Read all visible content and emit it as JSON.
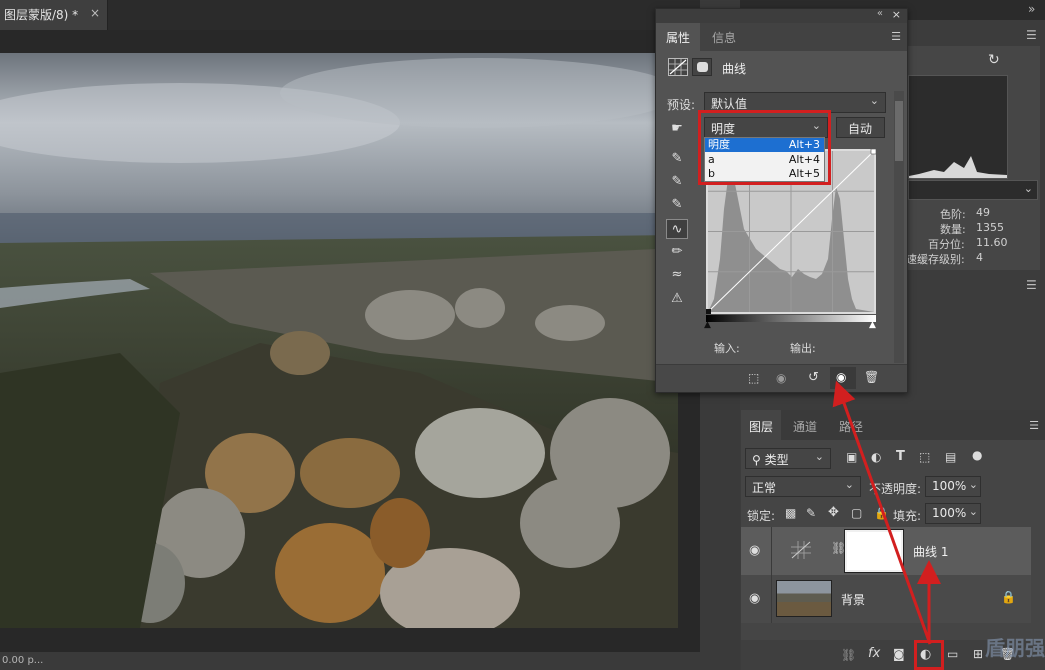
{
  "document": {
    "tab_title": "图层蒙版/8) *",
    "close_glyph": "×",
    "status_text": "0.00 p..."
  },
  "properties": {
    "tabs": [
      "属性",
      "信息"
    ],
    "adjustment_name": "曲线",
    "preset_label": "预设:",
    "preset_value": "默认值",
    "channel_value": "明度",
    "auto_button": "自动",
    "dropdown": [
      {
        "label": "明度",
        "shortcut": "Alt+3"
      },
      {
        "label": "a",
        "shortcut": "Alt+4"
      },
      {
        "label": "b",
        "shortcut": "Alt+5"
      }
    ],
    "input_label": "输入:",
    "output_label": "输出:"
  },
  "histogram": {
    "stats": [
      {
        "label": "色阶:",
        "value": "49"
      },
      {
        "label": "数量:",
        "value": "1355"
      },
      {
        "label": "百分位:",
        "value": "11.60"
      },
      {
        "label": "速缓存级别:",
        "value": "4"
      }
    ]
  },
  "layers_panel": {
    "tabs": [
      "图层",
      "通道",
      "路径"
    ],
    "filter_value": "类型",
    "blend_mode": "正常",
    "opacity_label": "不透明度:",
    "opacity_value": "100%",
    "lock_label": "锁定:",
    "fill_label": "填充:",
    "fill_value": "100%",
    "layers": [
      {
        "name": "曲线 1"
      },
      {
        "name": "背景"
      }
    ],
    "fx_label": "fx"
  },
  "watermark": "盾朋强",
  "colors": {
    "highlight_red": "#d21f1f",
    "selection_blue": "#1d6fd1"
  }
}
